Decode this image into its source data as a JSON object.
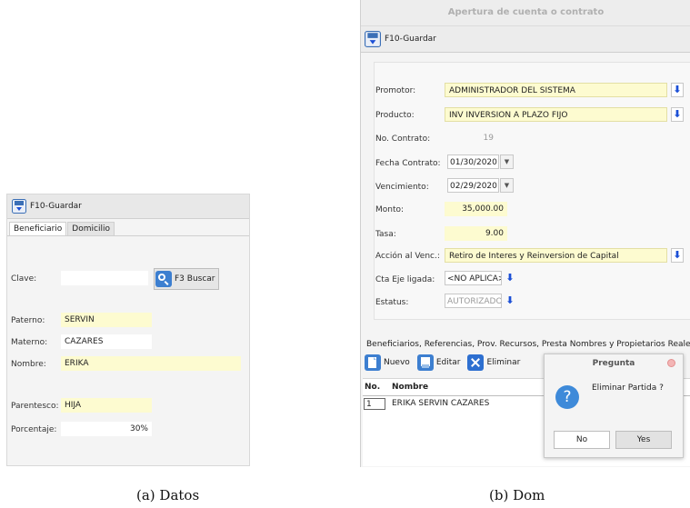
{
  "left": {
    "toolbar": {
      "save_label": "F10-Guardar"
    },
    "tabs": [
      {
        "label": "Beneficiario"
      },
      {
        "label": "Domicilio"
      }
    ],
    "clave": {
      "label": "Clave:",
      "value": ""
    },
    "search_button": {
      "label": "F3 Buscar"
    },
    "paterno": {
      "label": "Paterno:",
      "value": "SERVIN"
    },
    "materno": {
      "label": "Materno:",
      "value": "CAZARES"
    },
    "nombre": {
      "label": "Nombre:",
      "value": "ERIKA"
    },
    "parentesco": {
      "label": "Parentesco:",
      "value": "HIJA"
    },
    "porcentaje": {
      "label": "Porcentaje:",
      "value": "30%"
    }
  },
  "right": {
    "window_title": "Apertura de cuenta o contrato",
    "toolbar": {
      "save_label": "F10-Guardar"
    },
    "promotor": {
      "label": "Promotor:",
      "value": "ADMINISTRADOR DEL SISTEMA"
    },
    "producto": {
      "label": "Producto:",
      "value": "INV INVERSION A PLAZO FIJO"
    },
    "no_contrato": {
      "label": "No. Contrato:",
      "value": "19"
    },
    "fecha_contrato": {
      "label": "Fecha Contrato:",
      "value": "01/30/2020"
    },
    "vencimiento": {
      "label": "Vencimiento:",
      "value": "02/29/2020"
    },
    "monto": {
      "label": "Monto:",
      "value": "35,000.00"
    },
    "tasa": {
      "label": "Tasa:",
      "value": "9.00"
    },
    "accion": {
      "label": "Acción al Venc.:",
      "value": "Retiro de Interes y Reinversion de Capital"
    },
    "cta_eje": {
      "label": "Cta Eje ligada:",
      "value": "<NO APLICA>"
    },
    "estatus": {
      "label": "Estatus:",
      "value": "AUTORIZADO"
    },
    "section_title": "Beneficiarios, Referencias, Prov. Recursos, Presta Nombres y Propietarios Reale",
    "grid_toolbar": {
      "new_label": "Nuevo",
      "edit_label": "Editar",
      "delete_label": "Eliminar"
    },
    "grid": {
      "columns": [
        "No.",
        "Nombre"
      ],
      "rows": [
        {
          "no": "1",
          "nombre": "ERIKA SERVIN CAZARES"
        }
      ]
    },
    "dialog": {
      "title": "Pregunta",
      "message": "Eliminar Partida ?",
      "no_label": "No",
      "yes_label": "Yes"
    }
  },
  "captions": {
    "left": "(a)  Datos",
    "right": "(b)  Dom"
  },
  "colors": {
    "required_field": "#fdfbd0",
    "accent_blue": "#1b4fd6"
  }
}
